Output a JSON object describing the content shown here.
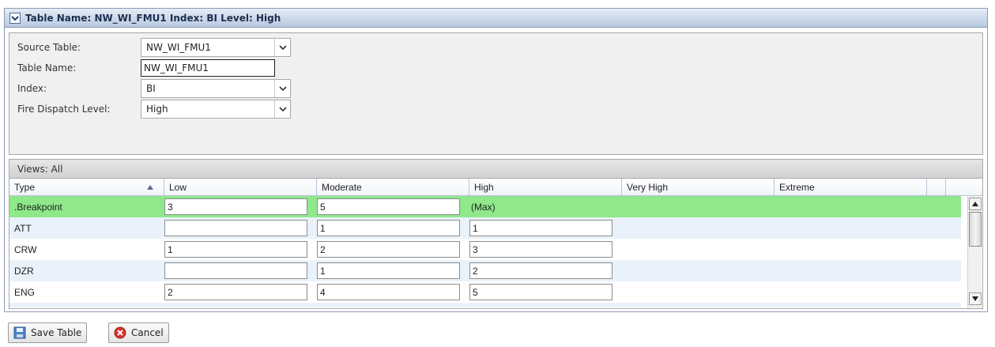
{
  "panel": {
    "title": "Table Name: NW_WI_FMU1 Index: BI Level: High"
  },
  "form": {
    "source_table": {
      "label": "Source Table:",
      "value": "NW_WI_FMU1"
    },
    "table_name": {
      "label": "Table Name:",
      "value": "NW_WI_FMU1"
    },
    "index": {
      "label": "Index:",
      "value": "BI"
    },
    "dispatch_level": {
      "label": "Fire Dispatch Level:",
      "value": "High"
    }
  },
  "grid": {
    "views_label": "Views:  All",
    "columns": [
      "Type",
      "Low",
      "Moderate",
      "High",
      "Very High",
      "Extreme"
    ],
    "rows": [
      {
        "type": ".Breakpoint",
        "low": "3",
        "moderate": "5",
        "high": "(Max)"
      },
      {
        "type": "ATT",
        "low": "",
        "moderate": "1",
        "high": "1"
      },
      {
        "type": "CRW",
        "low": "1",
        "moderate": "2",
        "high": "3"
      },
      {
        "type": "DZR",
        "low": "",
        "moderate": "1",
        "high": "2"
      },
      {
        "type": "ENG",
        "low": "2",
        "moderate": "4",
        "high": "5"
      }
    ]
  },
  "buttons": {
    "save": "Save Table",
    "cancel": "Cancel"
  },
  "colors": {
    "breakpoint_row": "#8fe88a",
    "alt_row": "#e9f2fb",
    "title_bar": "#b8c9e0"
  }
}
